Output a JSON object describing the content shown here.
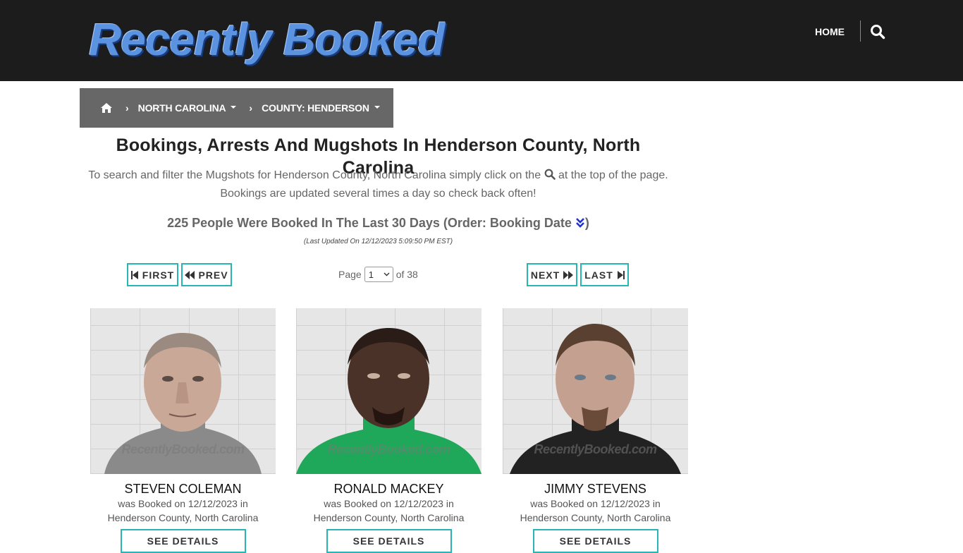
{
  "header": {
    "logo_text": "Recently Booked",
    "nav": {
      "home_label": "HOME",
      "search_icon": "search-icon"
    }
  },
  "breadcrumb": {
    "home_icon": "home-icon",
    "items": [
      {
        "label": "NORTH CAROLINA"
      },
      {
        "label": "COUNTY: HENDERSON"
      }
    ]
  },
  "main": {
    "title": "Bookings, Arrests And Mugshots In Henderson County, North Carolina",
    "intro_part1": "To search and filter the Mugshots for Henderson County, North Carolina simply click on the",
    "intro_part2": "at the top of the page. Bookings are updated several times a day so check back often!",
    "count_text": "225 People Were Booked In The Last 30 Days (Order: Booking Date",
    "count_close": ")",
    "last_updated": "(Last Updated On 12/12/2023 5:09:50 PM EST)"
  },
  "pagination": {
    "first_label": "FIRST",
    "prev_label": "PREV",
    "next_label": "NEXT",
    "last_label": "LAST",
    "page_label": "Page",
    "current_page": "1",
    "of_label": "of 38"
  },
  "cards": [
    {
      "name": "STEVEN COLEMAN",
      "line1": "was Booked on 12/12/2023 in",
      "line2": "Henderson County, North Carolina",
      "watermark": "RecentlyBooked.com",
      "button": "SEE DETAILS"
    },
    {
      "name": "RONALD MACKEY",
      "line1": "was Booked on 12/12/2023 in",
      "line2": "Henderson County, North Carolina",
      "watermark": "RecentlyBooked.com",
      "button": "SEE DETAILS"
    },
    {
      "name": "JIMMY STEVENS",
      "line1": "was Booked on 12/12/2023 in",
      "line2": "Henderson County, North Carolina",
      "watermark": "RecentlyBooked.com",
      "button": "SEE DETAILS"
    }
  ],
  "colors": {
    "header_bg": "#1c1c1c",
    "breadcrumb_bg": "#676767",
    "accent_border": "#2ab5b5",
    "order_icon": "#2233cc"
  }
}
